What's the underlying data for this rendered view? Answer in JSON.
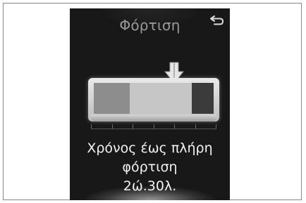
{
  "screen": {
    "title": "Φόρτιση",
    "back_icon": "back-arrow-icon",
    "charge_target_icon": "down-arrow-icon",
    "info_line_1": "Χρόνος έως πλήρη",
    "info_line_2": "φόρτιση",
    "info_line_3": "2ώ.30λ."
  },
  "battery": {
    "charged_fraction": 0.3,
    "target_fraction": 0.82,
    "scale_divisions": 6
  },
  "colors": {
    "screen_bg": "#181818",
    "title": "#9a9a9a",
    "text": "#f2f2f2"
  }
}
